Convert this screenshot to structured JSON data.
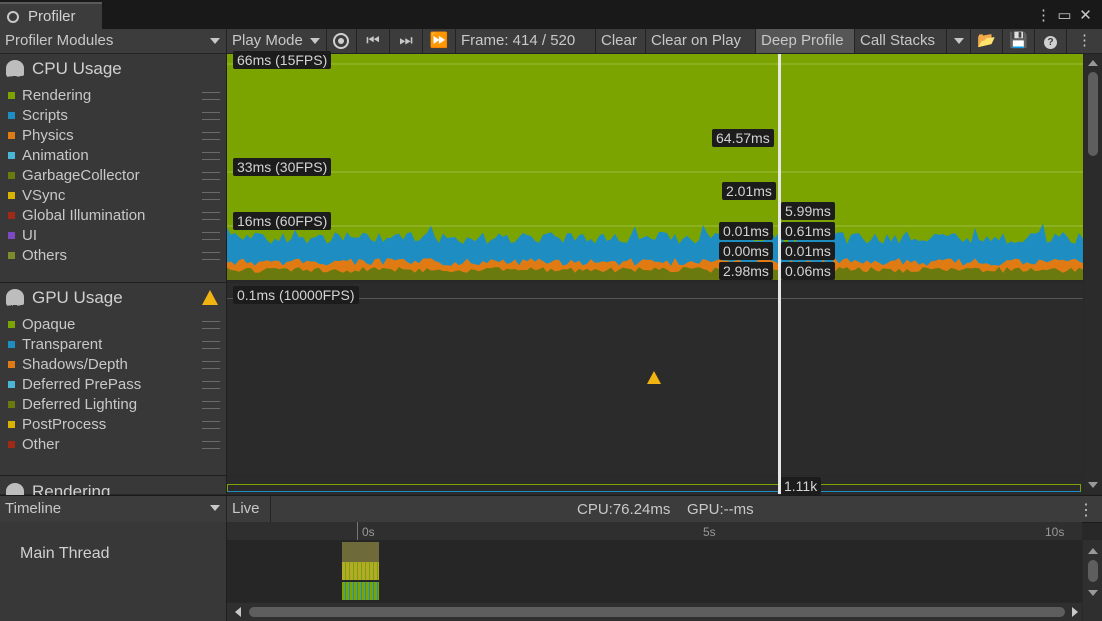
{
  "window": {
    "tab_title": "Profiler"
  },
  "toolbar": {
    "modules_label": "Profiler Modules",
    "play_mode_label": "Play Mode",
    "frame_label": "Frame: 414 / 520",
    "clear_label": "Clear",
    "clear_on_play_label": "Clear on Play",
    "deep_profile_label": "Deep Profile",
    "call_stacks_label": "Call Stacks"
  },
  "cpu": {
    "title": "CPU Usage",
    "legend": [
      {
        "label": "Rendering",
        "color": "#7ba400"
      },
      {
        "label": "Scripts",
        "color": "#1e8ec2"
      },
      {
        "label": "Physics",
        "color": "#e07b14"
      },
      {
        "label": "Animation",
        "color": "#4ab5d6"
      },
      {
        "label": "GarbageCollector",
        "color": "#6a7a0e"
      },
      {
        "label": "VSync",
        "color": "#d8b400"
      },
      {
        "label": "Global Illumination",
        "color": "#9e2a17"
      },
      {
        "label": "UI",
        "color": "#7b4ac2"
      },
      {
        "label": "Others",
        "color": "#7f8a2a"
      }
    ],
    "scale_labels": [
      "66ms (15FPS)",
      "33ms (30FPS)",
      "16ms (60FPS)"
    ],
    "value_labels_left": [
      "64.57ms",
      "2.01ms",
      "0.01ms",
      "0.00ms",
      "2.98ms"
    ],
    "value_labels_right": [
      "5.99ms",
      "0.61ms",
      "0.01ms",
      "0.06ms"
    ]
  },
  "gpu": {
    "title": "GPU Usage",
    "legend": [
      {
        "label": "Opaque",
        "color": "#7ba400"
      },
      {
        "label": "Transparent",
        "color": "#1e8ec2"
      },
      {
        "label": "Shadows/Depth",
        "color": "#e07b14"
      },
      {
        "label": "Deferred PrePass",
        "color": "#4ab5d6"
      },
      {
        "label": "Deferred Lighting",
        "color": "#6a7a0e"
      },
      {
        "label": "PostProcess",
        "color": "#d8b400"
      },
      {
        "label": "Other",
        "color": "#9e2a17"
      }
    ],
    "scale_label": "0.1ms (10000FPS)",
    "warning_icon": "warning-icon"
  },
  "rendering": {
    "title": "Rendering",
    "value_label": "1.11k"
  },
  "bottom": {
    "view_label": "Timeline",
    "live_label": "Live",
    "cpu_time": "CPU:76.24ms",
    "gpu_time": "GPU:--ms",
    "thread_label": "Main Thread",
    "ruler_ticks": [
      "0s",
      "5s",
      "10s"
    ]
  }
}
